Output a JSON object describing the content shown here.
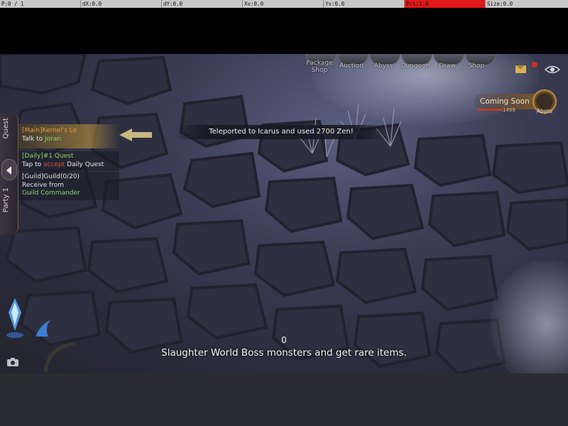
{
  "debug_overlay": {
    "pointer": "P:0 / 1",
    "dx": "dX:0.0",
    "dy": "dY:0.0",
    "xv": "Xv:0.0",
    "yv": "Yv:0.0",
    "prs": "Prs:1.0",
    "size": "Size:0.0"
  },
  "top_menu": {
    "items": [
      "Package Shop",
      "Auction",
      "Abyss",
      "Dungeon",
      "Draw",
      "Shop"
    ]
  },
  "event": {
    "label": "Coming Soon",
    "count": "1499",
    "badge_label": "Abyss"
  },
  "notice": {
    "prefix": "Teleported to Icarus and used ",
    "amount": "2700",
    "suffix": " Zen!"
  },
  "side_tabs": {
    "quest": "Quest",
    "party": "Party 1"
  },
  "quests": [
    {
      "tag": "[Main]",
      "title": "Kernel's Lo",
      "line2_pre": "Talk to ",
      "line2_target": "Joran"
    },
    {
      "tag": "[Daily]",
      "title": "#1 Quest",
      "line2_pre": "Tap to ",
      "line2_action": "accept",
      "line2_post": " Daily Quest"
    },
    {
      "tag": "[Guild]",
      "title": "Guild(0/20)",
      "line2_pre": "Receive from",
      "line3": "Guild Commander"
    }
  ],
  "bottom": {
    "count": "0",
    "hint": "Slaughter World Boss monsters and get rare items."
  },
  "colors": {
    "quest_main": "#e79a3e",
    "quest_link": "#8bd66a",
    "quest_accept": "#e04a3a",
    "debug_alert": "#e01818"
  }
}
